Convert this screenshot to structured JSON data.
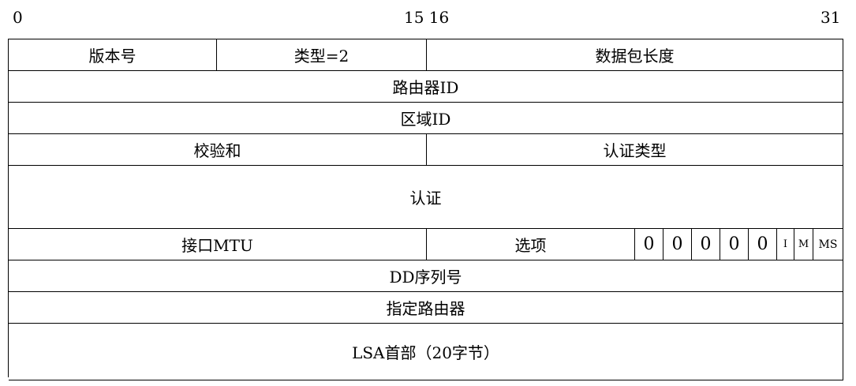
{
  "bit_labels": {
    "start": "0",
    "middle": "15 16",
    "end": "31"
  },
  "rows": [
    {
      "cells": [
        "版本号",
        "类型=2",
        "数据包长度"
      ]
    },
    {
      "cells": [
        "路由器ID"
      ]
    },
    {
      "cells": [
        "区域ID"
      ]
    },
    {
      "cells": [
        "校验和",
        "认证类型"
      ]
    },
    {
      "cells": [
        "认证"
      ]
    },
    {
      "cells": [
        "接口MTU",
        "选项"
      ],
      "flags": [
        "0",
        "0",
        "0",
        "0",
        "0",
        "I",
        "M",
        "MS"
      ]
    },
    {
      "cells": [
        "DD序列号"
      ]
    },
    {
      "cells": [
        "指定路由器"
      ]
    },
    {
      "cells": [
        "LSA首部（20字节）"
      ]
    }
  ]
}
